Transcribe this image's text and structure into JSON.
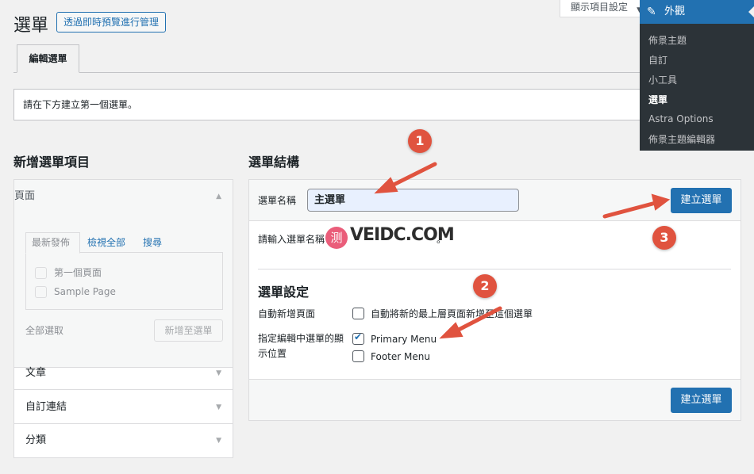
{
  "header": {
    "title": "選單",
    "live_preview_button": "透過即時預覽進行管理",
    "screen_options": "顯示項目設定"
  },
  "tabs": {
    "edit_menu": "編輯選單"
  },
  "notice": "請在下方建立第一個選單。",
  "add_items": {
    "heading": "新增選單項目",
    "sections": [
      "頁面",
      "文章",
      "自訂連結",
      "分類"
    ],
    "inner_tabs": [
      "最新發佈",
      "檢視全部",
      "搜尋"
    ],
    "pages": [
      "第一個頁面",
      "Sample Page"
    ],
    "select_all": "全部選取",
    "add_button": "新增至選單"
  },
  "structure": {
    "heading": "選單結構",
    "name_label": "選單名稱",
    "name_value": "主選單",
    "create_button": "建立選單",
    "hint": "請輸入選單名稱",
    "hint_tail": "。"
  },
  "settings": {
    "heading": "選單設定",
    "auto_add_label": "自動新增頁面",
    "auto_add_option": "自動將新的最上層頁面新增至這個選單",
    "location_label_line1": "指定編輯中選單的顯",
    "location_label_line2": "示位置",
    "locations": [
      {
        "label": "Primary Menu",
        "checked": true
      },
      {
        "label": "Footer Menu",
        "checked": false
      }
    ]
  },
  "admin_menu": {
    "top": "外觀",
    "items": [
      "佈景主題",
      "自訂",
      "小工具",
      "選單",
      "Astra Options",
      "佈景主題編輯器"
    ],
    "current": "選單"
  },
  "annotations": {
    "step1": "1",
    "step2": "2",
    "step3": "3",
    "watermark": "VEIDC.COM",
    "watermark_logo": "测"
  },
  "colors": {
    "primary": "#2271b1",
    "annotation_red": "#e0533f",
    "admin_dark": "#2c3338"
  }
}
